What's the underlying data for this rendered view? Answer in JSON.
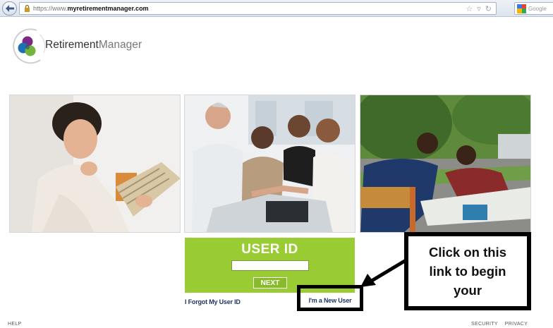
{
  "browser": {
    "url_prefix": "https://www.",
    "url_domain": "myretirementmanager.com",
    "search_placeholder": "Google"
  },
  "logo": {
    "text_part1": "Retirement",
    "text_part2": "Manager"
  },
  "login": {
    "title": "USER ID",
    "input_value": "",
    "next_label": "NEXT",
    "forgot_label": "I Forgot My User ID",
    "new_user_label": "I'm a New User"
  },
  "callout": {
    "lines": [
      "Click on this",
      "link to begin",
      "your"
    ]
  },
  "footer": {
    "help": "HELP",
    "security": "SECURITY",
    "privacy": "PRIVACY"
  },
  "colors": {
    "login_green": "#99cc33",
    "link_blue": "#1f3566"
  }
}
